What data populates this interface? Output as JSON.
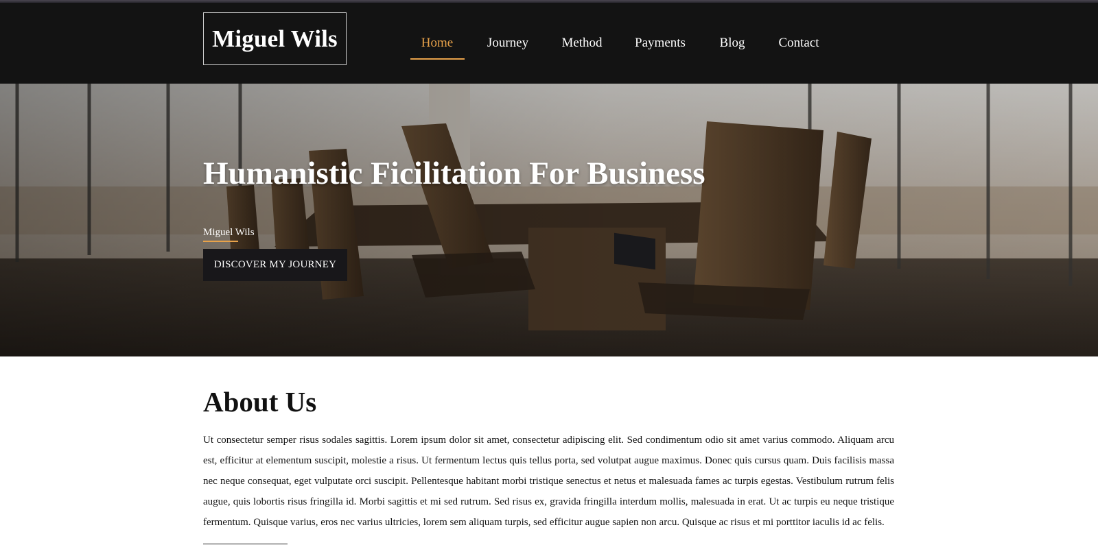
{
  "brand": {
    "name": "Miguel Wils"
  },
  "nav": {
    "items": [
      {
        "label": "Home",
        "active": true
      },
      {
        "label": "Journey",
        "active": false
      },
      {
        "label": "Method",
        "active": false
      },
      {
        "label": "Payments",
        "active": false
      },
      {
        "label": "Blog",
        "active": false
      },
      {
        "label": "Contact",
        "active": false
      }
    ]
  },
  "hero": {
    "title": "Humanistic Ficilitation For Business",
    "subtitle": "Miguel Wils",
    "cta_label": "DISCOVER MY JOURNEY"
  },
  "about": {
    "title": "About Us",
    "body": "Ut consectetur semper risus sodales sagittis. Lorem ipsum dolor sit amet, consectetur adipiscing elit. Sed condimentum odio sit amet varius commodo. Aliquam arcu est, efficitur at elementum suscipit, molestie a risus. Ut fermentum lectus quis tellus porta, sed volutpat augue maximus. Donec quis cursus quam. Duis facilisis massa nec neque consequat, eget vulputate orci suscipit. Pellentesque habitant morbi tristique senectus et netus et malesuada fames ac turpis egestas. Vestibulum rutrum felis augue, quis lobortis risus fringilla id. Morbi sagittis et mi sed rutrum. Sed risus ex, gravida fringilla interdum mollis, malesuada in erat. Ut ac turpis eu neque tristique fermentum. Quisque varius, eros nec varius ultricies, lorem sem aliquam turpis, sed efficitur augue sapien non arcu. Quisque ac risus et mi porttitor iaculis id ac felis."
  },
  "colors": {
    "accent": "#e8a24a",
    "header_bg": "#131313",
    "button_bg": "#18171a"
  }
}
